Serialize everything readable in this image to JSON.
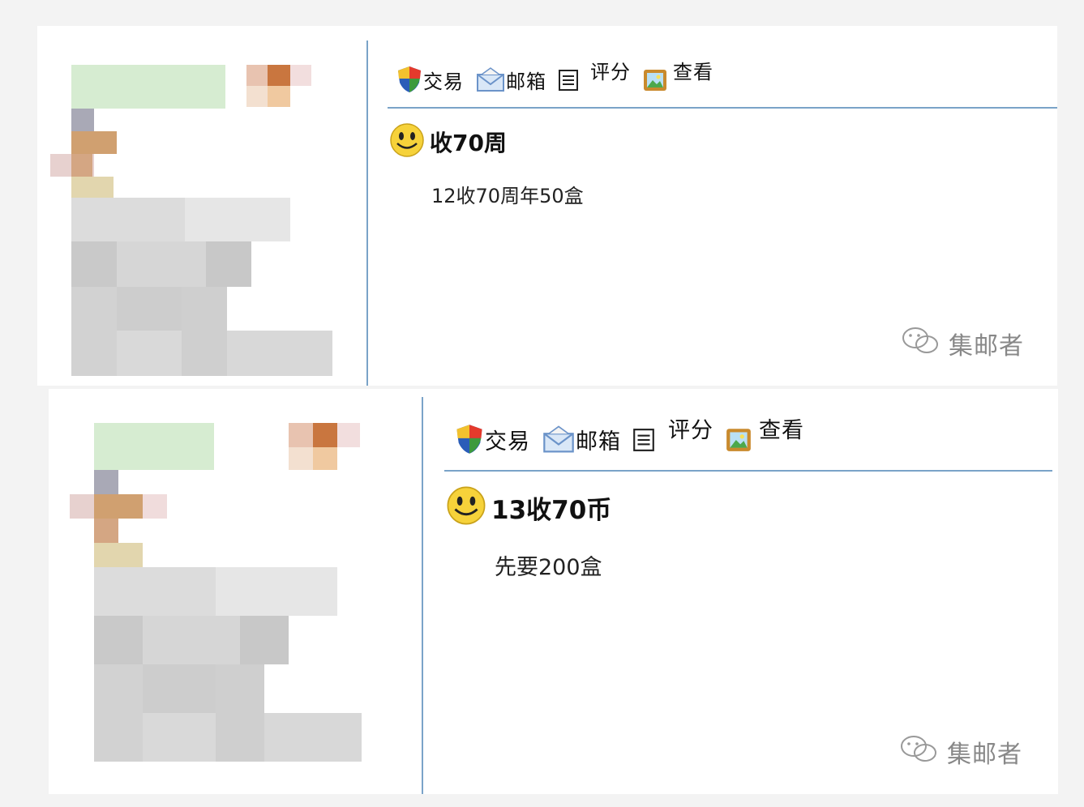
{
  "posts": [
    {
      "toolbar": {
        "trade": "交易",
        "mail": "邮箱",
        "rate": "评分",
        "view": "查看"
      },
      "title": "收70周",
      "body": "12收70周年50盒",
      "watermark": "集邮者"
    },
    {
      "toolbar": {
        "trade": "交易",
        "mail": "邮箱",
        "rate": "评分",
        "view": "查看"
      },
      "title": "13收70币",
      "body": "先要200盒",
      "watermark": "集邮者"
    }
  ],
  "icons": [
    "shield-icon",
    "envelope-icon",
    "notepad-icon",
    "picture-icon",
    "smiley-icon",
    "wechat-icon"
  ],
  "colors": {
    "divider": "#7aa3c8",
    "smiley": "#f6d23a",
    "avatar_orange": "#c9763f",
    "avatar_green": "#d6ecd1"
  }
}
